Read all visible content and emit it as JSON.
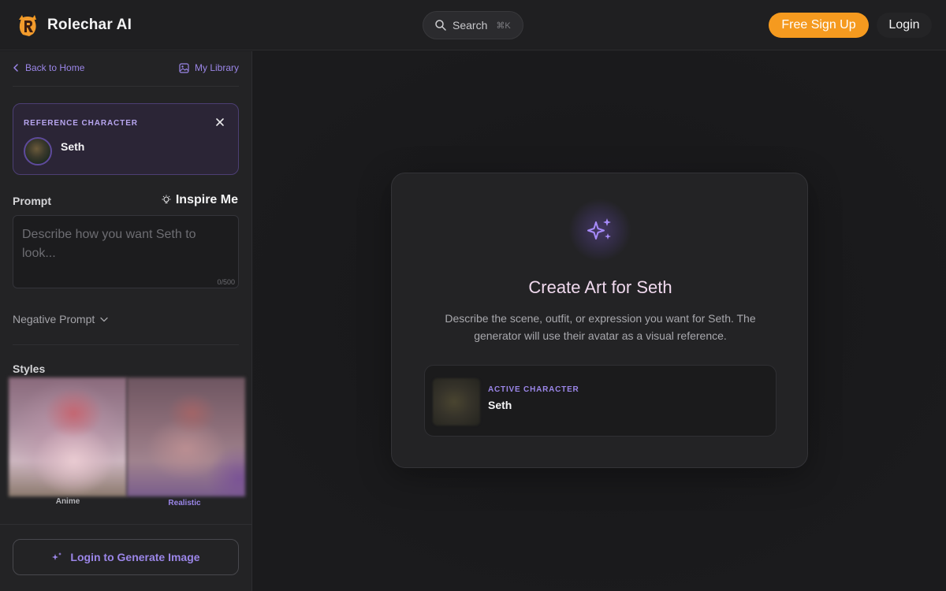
{
  "app": {
    "name": "Rolechar AI"
  },
  "header": {
    "search_label": "Search",
    "search_shortcut": "⌘K",
    "signup_label": "Free Sign Up",
    "login_label": "Login"
  },
  "sidebar": {
    "back_label": "Back to Home",
    "library_label": "My Library",
    "reference": {
      "label": "REFERENCE CHARACTER",
      "name": "Seth"
    },
    "prompt": {
      "label": "Prompt",
      "inspire_label": "Inspire Me",
      "placeholder": "Describe how you want Seth to look...",
      "value": "",
      "counter": "0/500"
    },
    "negative_prompt_label": "Negative Prompt",
    "styles_label": "Styles",
    "styles": [
      {
        "label": "Anime",
        "selected": false
      },
      {
        "label": "Realistic",
        "selected": true
      }
    ],
    "generate_label": "Login to Generate Image"
  },
  "main": {
    "title": "Create Art for Seth",
    "description": "Describe the scene, outfit, or expression you want for Seth. The generator will use their avatar as a visual reference.",
    "active": {
      "label": "ACTIVE CHARACTER",
      "name": "Seth"
    }
  },
  "colors": {
    "accent": "#9b86e8",
    "signup": "#f59a1f",
    "background": "#1c1c1e"
  }
}
